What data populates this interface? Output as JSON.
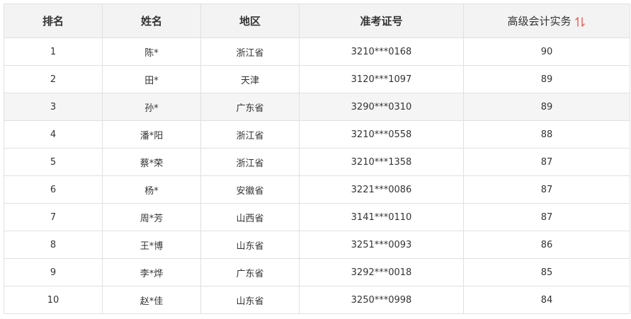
{
  "table": {
    "headers": [
      "排名",
      "姓名",
      "地区",
      "准考证号",
      "高级会计实务"
    ],
    "sort_icon": "sort-arrows-icon",
    "accent_color": "#e8584f",
    "rows": [
      [
        "1",
        "陈*",
        "浙江省",
        "3210***0168",
        "90"
      ],
      [
        "2",
        "田*",
        "天津",
        "3120***1097",
        "89"
      ],
      [
        "3",
        "孙*",
        "广东省",
        "3290***0310",
        "89"
      ],
      [
        "4",
        "潘*阳",
        "浙江省",
        "3210***0558",
        "88"
      ],
      [
        "5",
        "蔡*荣",
        "浙江省",
        "3210***1358",
        "87"
      ],
      [
        "6",
        "杨*",
        "安徽省",
        "3221***0086",
        "87"
      ],
      [
        "7",
        "周*芳",
        "山西省",
        "3141***0110",
        "87"
      ],
      [
        "8",
        "王*博",
        "山东省",
        "3251***0093",
        "86"
      ],
      [
        "9",
        "李*烨",
        "广东省",
        "3292***0018",
        "85"
      ],
      [
        "10",
        "赵*佳",
        "山东省",
        "3250***0998",
        "84"
      ]
    ]
  }
}
